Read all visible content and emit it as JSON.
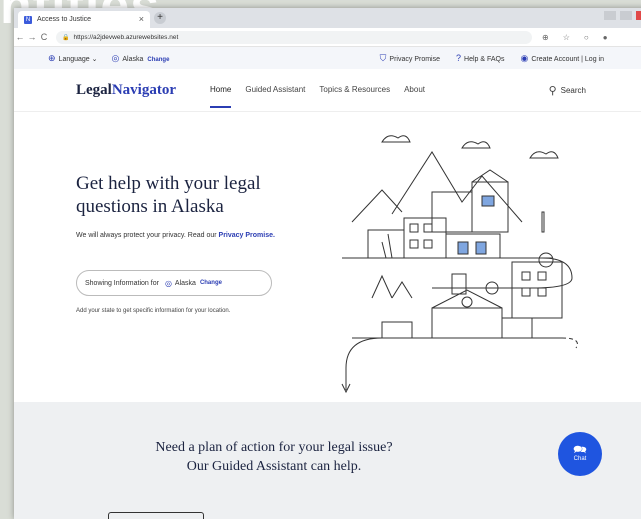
{
  "background": {
    "wordmark": "ntitles"
  },
  "browser": {
    "tab_title": "Access to Justice",
    "tab_close": "×",
    "new_tab": "+",
    "url": "https://a2jdevweb.azurewebsites.net",
    "back": "←",
    "forward": "→",
    "reload": "C"
  },
  "utility": {
    "language": "Language",
    "location": "Alaska",
    "change": "Change",
    "privacy_promise": "Privacy Promise",
    "help": "Help & FAQs",
    "account": "Create Account | Log in"
  },
  "nav": {
    "logo_legal": "Legal",
    "logo_navigator": "Navigator",
    "items": [
      "Home",
      "Guided Assistant",
      "Topics & Resources",
      "About"
    ],
    "search": "Search"
  },
  "hero": {
    "title": "Get help with your legal questions in Alaska",
    "privacy_text": "We will always protect your privacy. Read our",
    "privacy_link": "Privacy Promise.",
    "showing_label": "Showing Information for",
    "location": "Alaska",
    "change": "Change",
    "add_state": "Add your state to get specific information for your location."
  },
  "lower": {
    "plan_line1": "Need a plan of action for your legal issue?",
    "plan_line2": "Our Guided Assistant can help.",
    "chat": "Chat"
  },
  "colors": {
    "brand_blue": "#2b3db3",
    "navy": "#1b2340",
    "chat_blue": "#1f55e0"
  }
}
